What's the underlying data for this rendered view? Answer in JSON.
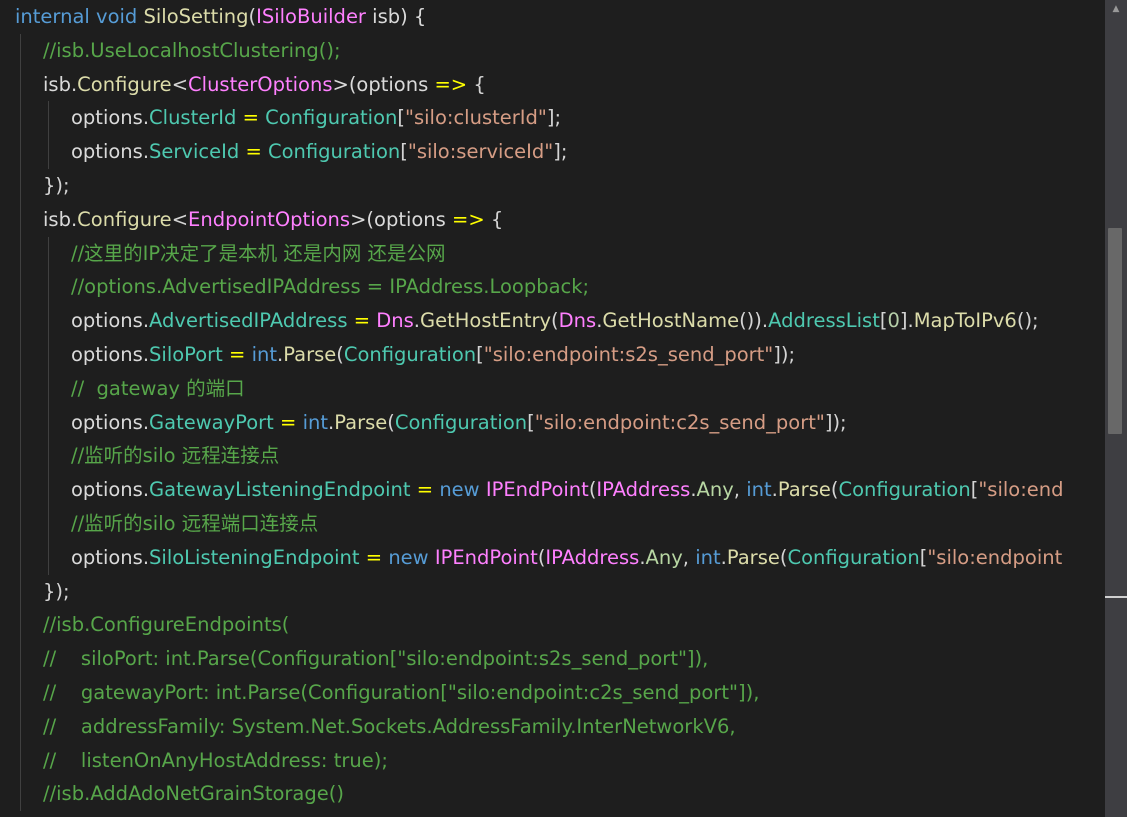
{
  "editor": {
    "language": "C#",
    "theme_background": "#1e1e1e",
    "colors": {
      "keyword": "#569cd6",
      "method": "#dcdcaa",
      "type": "#4ec9b0",
      "class": "#ff80ff",
      "string": "#d69d85",
      "number": "#b5cea8",
      "comment": "#57a64a",
      "arrow": "#ffff00",
      "text": "#d4d4d4"
    },
    "lines": [
      {
        "indent": 0,
        "tokens": [
          {
            "t": "internal",
            "c": "kw"
          },
          {
            "t": " ",
            "c": "punct"
          },
          {
            "t": "void",
            "c": "kw"
          },
          {
            "t": " ",
            "c": "punct"
          },
          {
            "t": "SiloSetting",
            "c": "fn"
          },
          {
            "t": "(",
            "c": "punct"
          },
          {
            "t": "ISiloBuilder",
            "c": "class"
          },
          {
            "t": " isb) {",
            "c": "local"
          }
        ]
      },
      {
        "indent": 1,
        "tokens": [
          {
            "t": "//isb.UseLocalhostClustering();",
            "c": "com"
          }
        ]
      },
      {
        "indent": 1,
        "tokens": [
          {
            "t": "isb",
            "c": "local"
          },
          {
            "t": ".",
            "c": "punct"
          },
          {
            "t": "Configure",
            "c": "fn"
          },
          {
            "t": "<",
            "c": "punct"
          },
          {
            "t": "ClusterOptions",
            "c": "class"
          },
          {
            "t": ">(options ",
            "c": "local"
          },
          {
            "t": "=>",
            "c": "arrow"
          },
          {
            "t": " {",
            "c": "punct"
          }
        ]
      },
      {
        "indent": 2,
        "tokens": [
          {
            "t": "options",
            "c": "local"
          },
          {
            "t": ".",
            "c": "punct"
          },
          {
            "t": "ClusterId",
            "c": "prop"
          },
          {
            "t": " ",
            "c": "punct"
          },
          {
            "t": "=",
            "c": "arrow"
          },
          {
            "t": " ",
            "c": "punct"
          },
          {
            "t": "Configuration",
            "c": "prop"
          },
          {
            "t": "[",
            "c": "punct"
          },
          {
            "t": "\"silo:clusterId\"",
            "c": "str"
          },
          {
            "t": "];",
            "c": "punct"
          }
        ]
      },
      {
        "indent": 2,
        "tokens": [
          {
            "t": "options",
            "c": "local"
          },
          {
            "t": ".",
            "c": "punct"
          },
          {
            "t": "ServiceId",
            "c": "prop"
          },
          {
            "t": " ",
            "c": "punct"
          },
          {
            "t": "=",
            "c": "arrow"
          },
          {
            "t": " ",
            "c": "punct"
          },
          {
            "t": "Configuration",
            "c": "prop"
          },
          {
            "t": "[",
            "c": "punct"
          },
          {
            "t": "\"silo:serviceId\"",
            "c": "str"
          },
          {
            "t": "];",
            "c": "punct"
          }
        ]
      },
      {
        "indent": 1,
        "tokens": [
          {
            "t": "});",
            "c": "punct"
          }
        ]
      },
      {
        "indent": 1,
        "tokens": [
          {
            "t": "isb",
            "c": "local"
          },
          {
            "t": ".",
            "c": "punct"
          },
          {
            "t": "Configure",
            "c": "fn"
          },
          {
            "t": "<",
            "c": "punct"
          },
          {
            "t": "EndpointOptions",
            "c": "class"
          },
          {
            "t": ">(options ",
            "c": "local"
          },
          {
            "t": "=>",
            "c": "arrow"
          },
          {
            "t": " {",
            "c": "punct"
          }
        ]
      },
      {
        "indent": 2,
        "tokens": [
          {
            "t": "//这里的IP决定了是本机 还是内网 还是公网",
            "c": "com"
          }
        ]
      },
      {
        "indent": 2,
        "tokens": [
          {
            "t": "//options.AdvertisedIPAddress = IPAddress.Loopback;",
            "c": "com"
          }
        ]
      },
      {
        "indent": 2,
        "tokens": [
          {
            "t": "options",
            "c": "local"
          },
          {
            "t": ".",
            "c": "punct"
          },
          {
            "t": "AdvertisedIPAddress",
            "c": "prop"
          },
          {
            "t": " ",
            "c": "punct"
          },
          {
            "t": "=",
            "c": "arrow"
          },
          {
            "t": " ",
            "c": "punct"
          },
          {
            "t": "Dns",
            "c": "class"
          },
          {
            "t": ".",
            "c": "punct"
          },
          {
            "t": "GetHostEntry",
            "c": "fn"
          },
          {
            "t": "(",
            "c": "punct"
          },
          {
            "t": "Dns",
            "c": "class"
          },
          {
            "t": ".",
            "c": "punct"
          },
          {
            "t": "GetHostName",
            "c": "fn"
          },
          {
            "t": "()).",
            "c": "punct"
          },
          {
            "t": "AddressList",
            "c": "prop"
          },
          {
            "t": "[",
            "c": "punct"
          },
          {
            "t": "0",
            "c": "num"
          },
          {
            "t": "].",
            "c": "punct"
          },
          {
            "t": "MapToIPv6",
            "c": "fn"
          },
          {
            "t": "();",
            "c": "punct"
          }
        ]
      },
      {
        "indent": 2,
        "tokens": [
          {
            "t": "options",
            "c": "local"
          },
          {
            "t": ".",
            "c": "punct"
          },
          {
            "t": "SiloPort",
            "c": "prop"
          },
          {
            "t": " ",
            "c": "punct"
          },
          {
            "t": "=",
            "c": "arrow"
          },
          {
            "t": " ",
            "c": "punct"
          },
          {
            "t": "int",
            "c": "kw"
          },
          {
            "t": ".",
            "c": "punct"
          },
          {
            "t": "Parse",
            "c": "fn"
          },
          {
            "t": "(",
            "c": "punct"
          },
          {
            "t": "Configuration",
            "c": "prop"
          },
          {
            "t": "[",
            "c": "punct"
          },
          {
            "t": "\"silo:endpoint:s2s_send_port\"",
            "c": "str"
          },
          {
            "t": "]);",
            "c": "punct"
          }
        ]
      },
      {
        "indent": 2,
        "tokens": [
          {
            "t": "//  gateway 的端口",
            "c": "com"
          }
        ]
      },
      {
        "indent": 2,
        "tokens": [
          {
            "t": "options",
            "c": "local"
          },
          {
            "t": ".",
            "c": "punct"
          },
          {
            "t": "GatewayPort",
            "c": "prop"
          },
          {
            "t": " ",
            "c": "punct"
          },
          {
            "t": "=",
            "c": "arrow"
          },
          {
            "t": " ",
            "c": "punct"
          },
          {
            "t": "int",
            "c": "kw"
          },
          {
            "t": ".",
            "c": "punct"
          },
          {
            "t": "Parse",
            "c": "fn"
          },
          {
            "t": "(",
            "c": "punct"
          },
          {
            "t": "Configuration",
            "c": "prop"
          },
          {
            "t": "[",
            "c": "punct"
          },
          {
            "t": "\"silo:endpoint:c2s_send_port\"",
            "c": "str"
          },
          {
            "t": "]);",
            "c": "punct"
          }
        ]
      },
      {
        "indent": 2,
        "tokens": [
          {
            "t": "//监听的silo 远程连接点",
            "c": "com"
          }
        ]
      },
      {
        "indent": 2,
        "tokens": [
          {
            "t": "options",
            "c": "local"
          },
          {
            "t": ".",
            "c": "punct"
          },
          {
            "t": "GatewayListeningEndpoint",
            "c": "prop"
          },
          {
            "t": " ",
            "c": "punct"
          },
          {
            "t": "=",
            "c": "arrow"
          },
          {
            "t": " ",
            "c": "punct"
          },
          {
            "t": "new",
            "c": "kw"
          },
          {
            "t": " ",
            "c": "punct"
          },
          {
            "t": "IPEndPoint",
            "c": "class"
          },
          {
            "t": "(",
            "c": "punct"
          },
          {
            "t": "IPAddress",
            "c": "class"
          },
          {
            "t": ".",
            "c": "punct"
          },
          {
            "t": "Any",
            "c": "iface"
          },
          {
            "t": ", ",
            "c": "punct"
          },
          {
            "t": "int",
            "c": "kw"
          },
          {
            "t": ".",
            "c": "punct"
          },
          {
            "t": "Parse",
            "c": "fn"
          },
          {
            "t": "(",
            "c": "punct"
          },
          {
            "t": "Configuration",
            "c": "prop"
          },
          {
            "t": "[",
            "c": "punct"
          },
          {
            "t": "\"silo:end",
            "c": "str"
          }
        ]
      },
      {
        "indent": 2,
        "tokens": [
          {
            "t": "//监听的silo 远程端口连接点",
            "c": "com"
          }
        ]
      },
      {
        "indent": 2,
        "tokens": [
          {
            "t": "options",
            "c": "local"
          },
          {
            "t": ".",
            "c": "punct"
          },
          {
            "t": "SiloListeningEndpoint",
            "c": "prop"
          },
          {
            "t": " ",
            "c": "punct"
          },
          {
            "t": "=",
            "c": "arrow"
          },
          {
            "t": " ",
            "c": "punct"
          },
          {
            "t": "new",
            "c": "kw"
          },
          {
            "t": " ",
            "c": "punct"
          },
          {
            "t": "IPEndPoint",
            "c": "class"
          },
          {
            "t": "(",
            "c": "punct"
          },
          {
            "t": "IPAddress",
            "c": "class"
          },
          {
            "t": ".",
            "c": "punct"
          },
          {
            "t": "Any",
            "c": "iface"
          },
          {
            "t": ", ",
            "c": "punct"
          },
          {
            "t": "int",
            "c": "kw"
          },
          {
            "t": ".",
            "c": "punct"
          },
          {
            "t": "Parse",
            "c": "fn"
          },
          {
            "t": "(",
            "c": "punct"
          },
          {
            "t": "Configuration",
            "c": "prop"
          },
          {
            "t": "[",
            "c": "punct"
          },
          {
            "t": "\"silo:endpoint",
            "c": "str"
          }
        ]
      },
      {
        "indent": 1,
        "tokens": [
          {
            "t": "});",
            "c": "punct"
          }
        ]
      },
      {
        "indent": 1,
        "tokens": [
          {
            "t": "//isb.ConfigureEndpoints(",
            "c": "com"
          }
        ]
      },
      {
        "indent": 1,
        "tokens": [
          {
            "t": "//    siloPort: int.Parse(Configuration[\"silo:endpoint:s2s_send_port\"]),",
            "c": "com"
          }
        ]
      },
      {
        "indent": 1,
        "tokens": [
          {
            "t": "//    gatewayPort: int.Parse(Configuration[\"silo:endpoint:c2s_send_port\"]),",
            "c": "com"
          }
        ]
      },
      {
        "indent": 1,
        "tokens": [
          {
            "t": "//    addressFamily: System.Net.Sockets.AddressFamily.InterNetworkV6,",
            "c": "com"
          }
        ]
      },
      {
        "indent": 1,
        "tokens": [
          {
            "t": "//    listenOnAnyHostAddress: true);",
            "c": "com"
          }
        ]
      },
      {
        "indent": 1,
        "tokens": [
          {
            "t": "//isb.AddAdoNetGrainStorage()",
            "c": "com"
          }
        ]
      }
    ]
  },
  "scrollbar": {
    "up_arrow_glyph": "▲",
    "thumb_icon": "scroll-thumb"
  }
}
